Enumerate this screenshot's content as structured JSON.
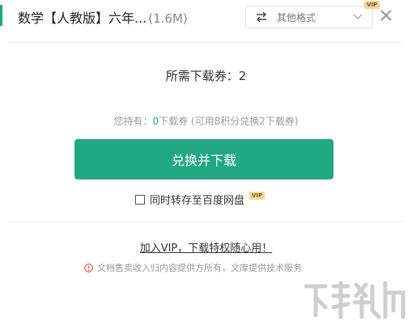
{
  "header": {
    "title": "数学【人教版】六年...",
    "file_size": "(1.6M)",
    "format_select_label": "其他格式",
    "vip_badge": "VIP"
  },
  "main": {
    "required_tickets": "所需下载券：2",
    "holding_prefix": "您持有：",
    "holding_count": "0",
    "holding_suffix": "下载券 (可用8积分兑换2下载券)",
    "download_button": "兑换并下载",
    "save_checkbox_label": "同时转存至百度网盘",
    "save_vip_badge": "VIP",
    "save_checked": false
  },
  "footer": {
    "vip_promo_link": "加入VIP，下载特权随心用！",
    "notice": "文档售卖收入归内容提供方所有，文库提供技术服务"
  },
  "colors": {
    "accent": "#22a882",
    "notice_icon": "#e0504a",
    "vip_badge_bg": "#f3d59a"
  }
}
